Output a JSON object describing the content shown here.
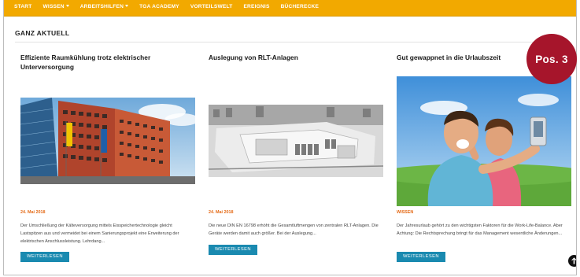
{
  "nav": {
    "items": [
      {
        "label": "START",
        "has_dropdown": false
      },
      {
        "label": "WISSEN",
        "has_dropdown": true
      },
      {
        "label": "ARBEITSHILFEN",
        "has_dropdown": true
      },
      {
        "label": "TGA ACADEMY",
        "has_dropdown": false
      },
      {
        "label": "VORTEILSWELT",
        "has_dropdown": false
      },
      {
        "label": "EREIGNIS",
        "has_dropdown": false
      },
      {
        "label": "BÜCHERECKE",
        "has_dropdown": false
      }
    ],
    "color": "#f2a900"
  },
  "section": {
    "title": "GANZ AKTUELL"
  },
  "cards": [
    {
      "title": "Effiziente Raumkühlung trotz elektrischer Unterversorgung",
      "image_icon": "office-building-photo",
      "date": "24. Mai 2018",
      "text": "Der Umschließung der Kälteversorgung mittels Eisspeichertechnologie gleicht Lastspitzen aus und vermeidet bei einem Sanierungsprojekt eine Erweiterung der elektrischen Anschlussleistung. Lehrdang...",
      "button": "WEITERLESEN"
    },
    {
      "title": "Auslegung von RLT-Anlagen",
      "image_icon": "rooftop-hvac-unit-photo",
      "date": "24. Mai 2018",
      "text": "Die neue DIN EN 16798 erhöht die Gesamtluftmengen von zentralen RLT-Anlagen. Die Geräte werden damit auch größer. Bei der Auslegung...",
      "button": "WEITERLESEN"
    },
    {
      "title": "Gut gewappnet in die Urlaubszeit",
      "image_icon": "vacation-couple-selfie-photo",
      "date": "WISSEN",
      "text": "Der Jahresurlaub gehört zu den wichtigsten Faktoren für die Work-Life-Balance. Aber Achtung: Die Rechtsprechung bringt für das Management wesentliche Änderungen...",
      "button": "WEITERLESEN"
    }
  ],
  "badge": {
    "label": "Pos. 3",
    "color": "#a6152b"
  },
  "scroll_top_icon": "arrow-up-circle-icon",
  "colors": {
    "accent": "#e46a16",
    "button": "#1a8ab0"
  }
}
